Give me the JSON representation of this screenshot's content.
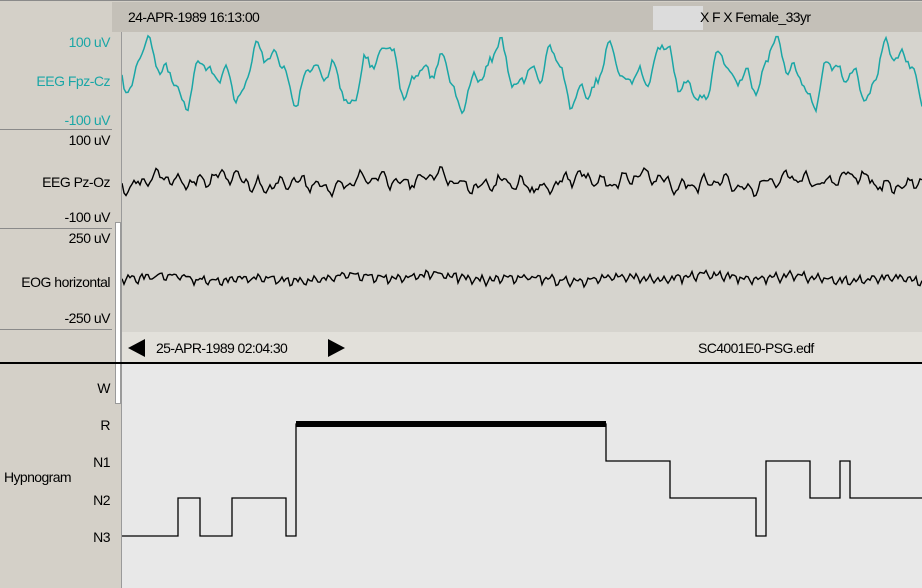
{
  "header": {
    "recording_start": "24-APR-1989 16:13:00",
    "subject": "X F X Female_33yr"
  },
  "channels": [
    {
      "name": "EEG Fpz-Cz",
      "scale_top": "100 uV",
      "scale_bottom": "-100 uV",
      "color": "#1aa6a6"
    },
    {
      "name": "EEG Pz-Oz",
      "scale_top": "100 uV",
      "scale_bottom": "-100 uV",
      "color": "#000000"
    },
    {
      "name": "EOG horizontal",
      "scale_top": "250 uV",
      "scale_bottom": "-250 uV",
      "color": "#000000"
    }
  ],
  "navigation": {
    "current_time": "25-APR-1989 02:04:30",
    "filename": "SC4001E0-PSG.edf"
  },
  "hypnogram": {
    "label": "Hypnogram",
    "stages": [
      "W",
      "R",
      "N1",
      "N2",
      "N3"
    ],
    "cursor_color": "#000000"
  }
}
